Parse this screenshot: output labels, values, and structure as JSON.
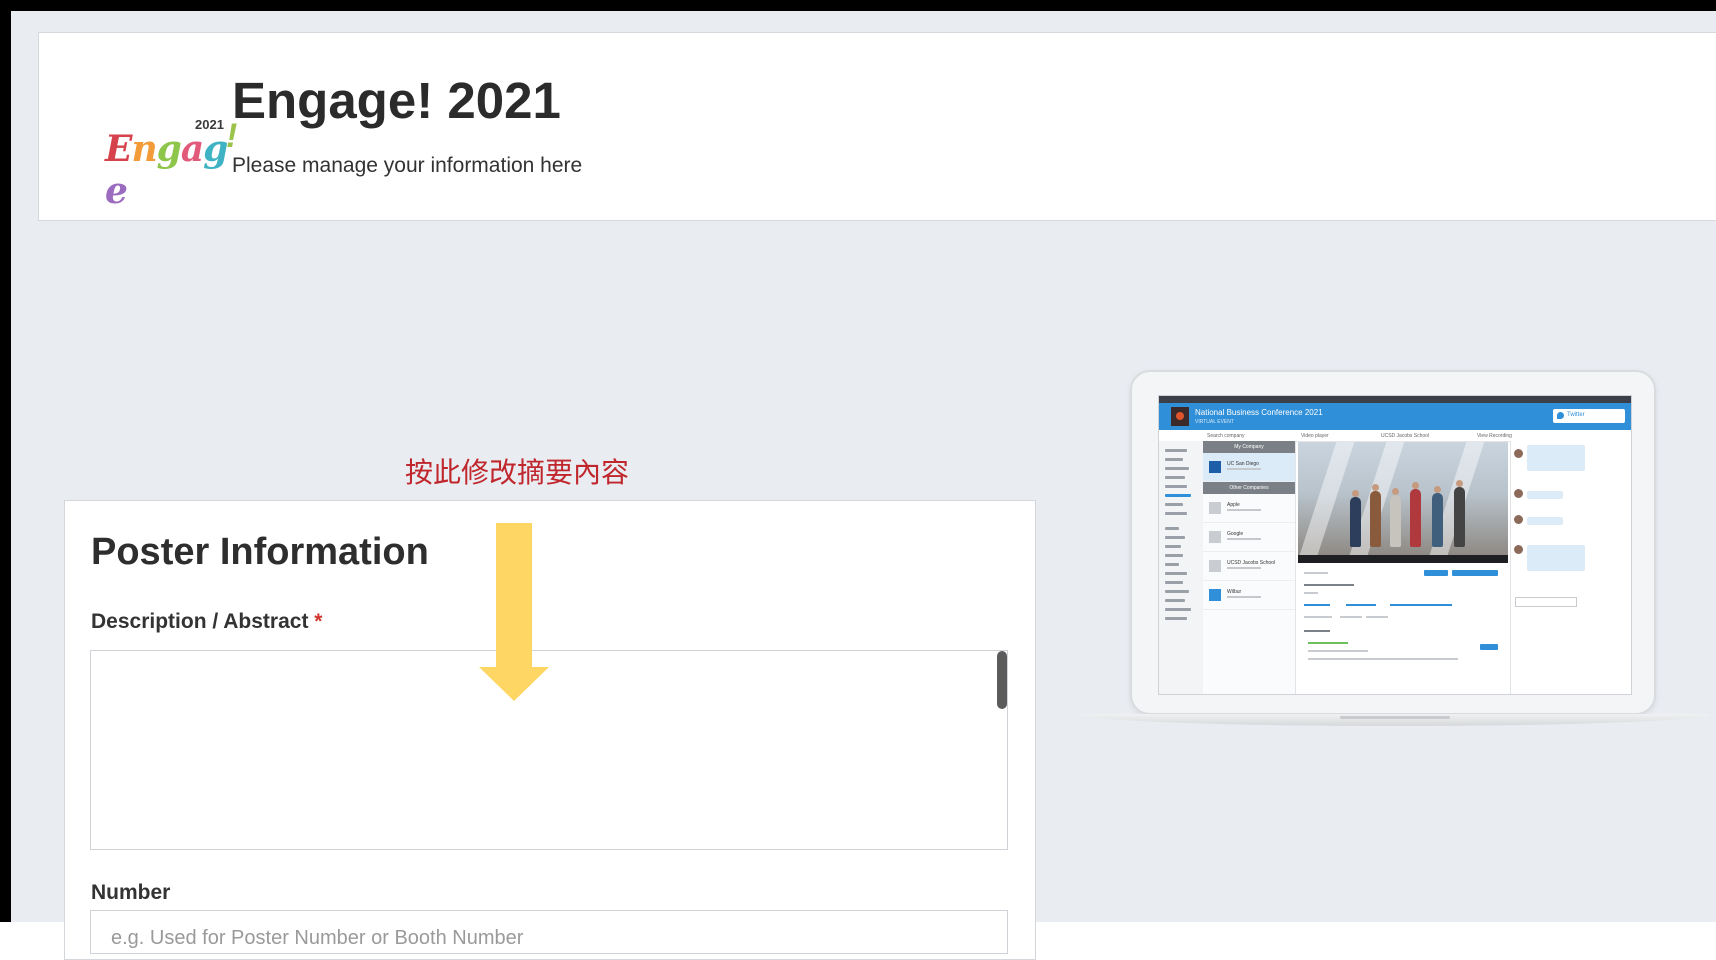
{
  "header": {
    "logo": {
      "word": "Engage",
      "year": "2021",
      "letters_colors": [
        "#d6424b",
        "#f29b38",
        "#8ec64c",
        "#e15a7a",
        "#3fb3c4",
        "#9b6bbf"
      ]
    },
    "title": "Engage! 2021",
    "subtitle": "Please manage your information here"
  },
  "annotation": {
    "text": "按此修改摘要內容",
    "color": "#c0272d"
  },
  "arrow": {
    "color": "#fdd663"
  },
  "poster": {
    "title": "Poster Information",
    "description_label": "Description / Abstract",
    "required_mark": "*",
    "description_value": "",
    "number_label": "Number",
    "number_placeholder": "e.g. Used for Poster Number or Booth Number",
    "number_value": ""
  },
  "mockup": {
    "brand_title": "National Business Conference 2021",
    "brand_subtitle": "VIRTUAL EVENT",
    "twitter_label": "Twitter",
    "tabs": [
      "Search company",
      "Video player",
      "UCSD Jacobs School",
      "View Recording"
    ],
    "list_headers": [
      "My Company",
      "Other Companies"
    ],
    "companies": [
      "UC San Diego",
      "Apple",
      "Google",
      "UCSD Jacobs School",
      "Wilbur"
    ]
  },
  "colors": {
    "background": "#e9edf2",
    "card": "#ffffff",
    "accent_blue": "#2f8fd8",
    "required": "#d0342c"
  }
}
